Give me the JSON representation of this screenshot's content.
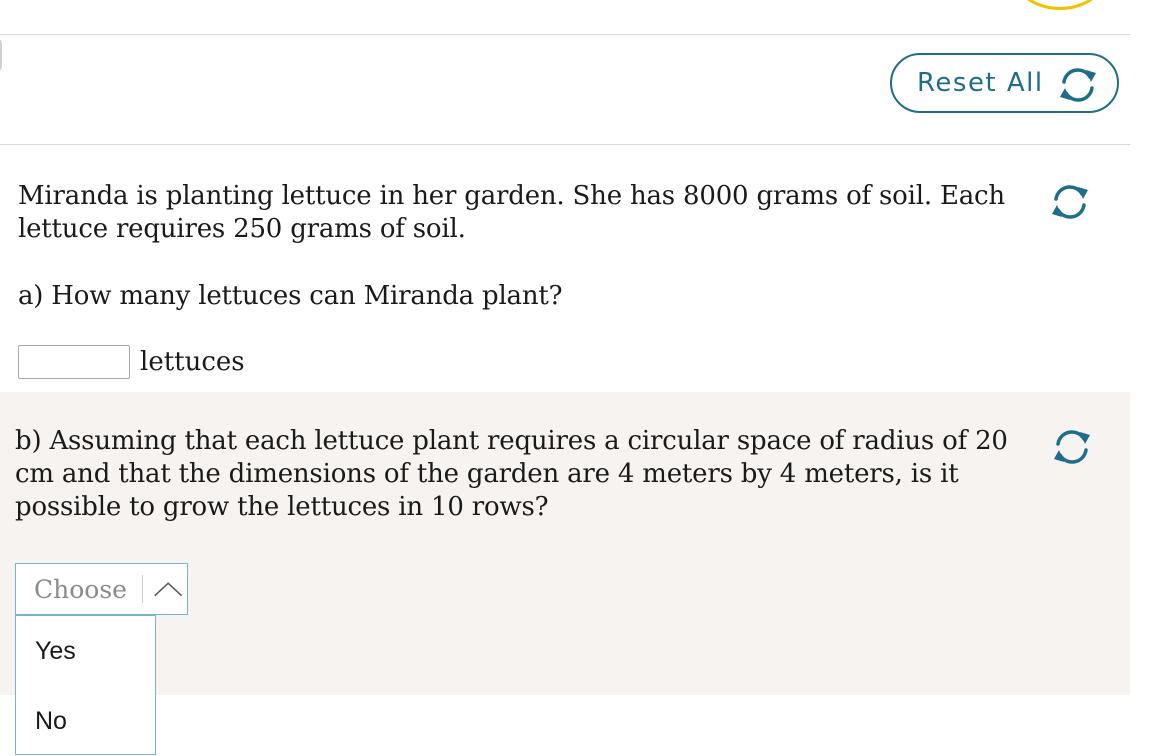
{
  "header": {
    "reset_all_label": "Reset All",
    "accent_color": "#1e6d8c"
  },
  "question": {
    "intro_line1": "Miranda is planting lettuce in her garden. She has 8000 grams of soil. Each",
    "intro_line2": "lettuce requires 250 grams of soil.",
    "part_a": {
      "prompt": "a) How many lettuces can Miranda plant?",
      "answer_value": "",
      "unit": "lettuces"
    },
    "part_b": {
      "prompt_line1": "b) Assuming that each lettuce plant requires a circular space of radius of 20",
      "prompt_line2": "cm and that the dimensions of the garden are 4 meters by 4 meters, is it",
      "prompt_line3": "possible to grow the lettuces in 10 rows?",
      "select_placeholder": "Choose",
      "options": [
        "Yes",
        "No"
      ]
    }
  },
  "icons": {
    "reset": "refresh-icon",
    "dropdown": "chevron-up-icon"
  }
}
